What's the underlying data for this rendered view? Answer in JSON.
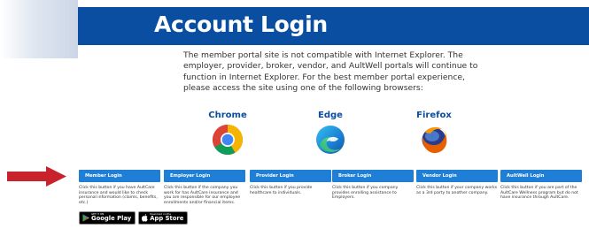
{
  "header": {
    "title": "Account Login"
  },
  "notice": "The member portal site is not compatible with Internet Explorer. The employer, provider, broker, vendor, and AultWell portals will continue to function in Internet Explorer. For the best member portal experience, please access the site using one of the following browsers:",
  "browsers": [
    {
      "name": "Chrome",
      "icon": "chrome-icon"
    },
    {
      "name": "Edge",
      "icon": "edge-icon"
    },
    {
      "name": "Firefox",
      "icon": "firefox-icon"
    }
  ],
  "portals": [
    {
      "label": "Member Login",
      "description": "Click this button if you have AultCare insurance and would like to check personal information (claims, benefits, etc.)"
    },
    {
      "label": "Employer Login",
      "description": "Click this button if the company you work for has AultCare insurance and you are responsible for our employee enrollments and/or financial items."
    },
    {
      "label": "Provider Login",
      "description": "Click this button if you provide healthcare to individuals."
    },
    {
      "label": "Broker Login",
      "description": "Click this button if you company provides enrolling assistance to Employers."
    },
    {
      "label": "Vendor Login",
      "description": "Click this button if your company works as a 3rd party to another company."
    },
    {
      "label": "AultWell Login",
      "description": "Click this button if you are part of the AultCare Wellness program but do not have insurance through AultCare."
    }
  ],
  "stores": {
    "google": {
      "small": "GET IT ON",
      "big": "Google Play"
    },
    "apple": {
      "small": "Download on the",
      "big": "App Store"
    }
  },
  "colors": {
    "header_blue": "#0a4ea2",
    "button_blue": "#1f7fd6",
    "arrow_red": "#c8232c"
  }
}
